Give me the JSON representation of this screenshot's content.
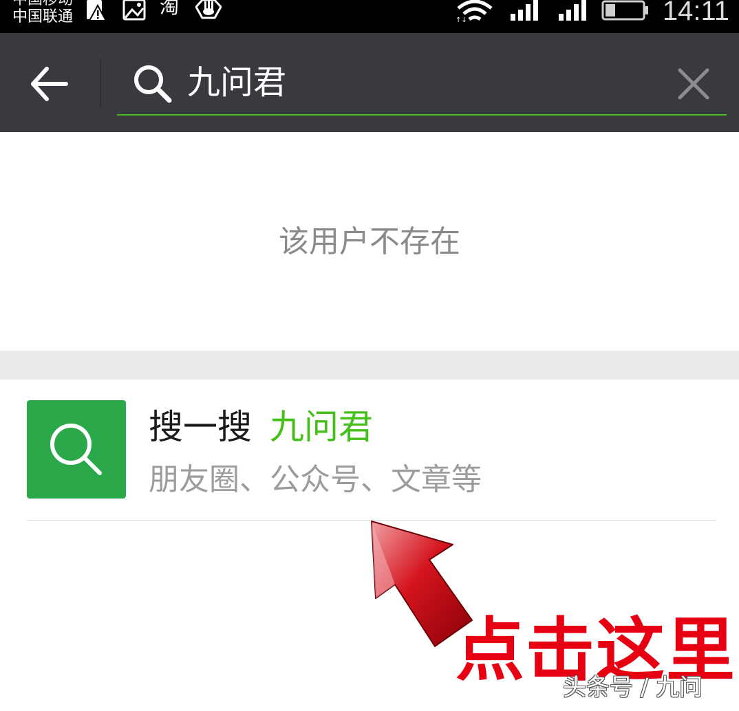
{
  "status_bar": {
    "carrier_primary": "中国移动",
    "carrier_secondary": "中国联通",
    "clock": "14:11",
    "icons": [
      "sim-alert-icon",
      "image-icon",
      "taobao-icon",
      "hand-icon",
      "wifi-icon",
      "signal-icon",
      "signal-icon",
      "battery-icon"
    ],
    "app_icon_label": "淘"
  },
  "search_bar": {
    "query": "九问君",
    "accent_color": "#45c01a",
    "background_color": "#393a3f"
  },
  "results": {
    "empty_message": "该用户不存在",
    "search_row": {
      "title": "搜一搜",
      "keyword": "九问君",
      "subtitle": "朋友圈、公众号、文章等",
      "tile_color": "#2aa84a"
    }
  },
  "annotation": {
    "text": "点击这里",
    "color": "#e60012"
  },
  "watermark": "头条号 / 九问"
}
